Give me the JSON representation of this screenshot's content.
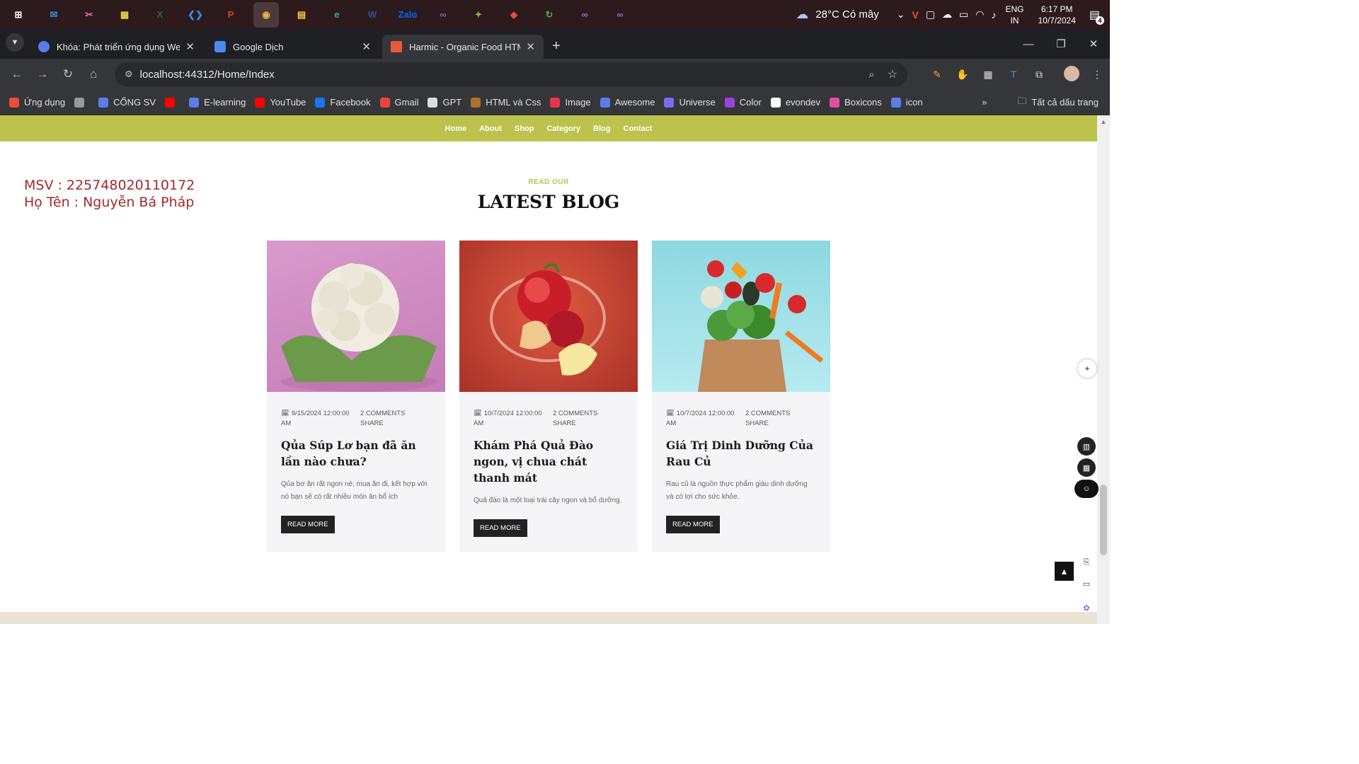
{
  "taskbar": {
    "apps": [
      {
        "name": "windows-start-icon",
        "glyph": "⊞",
        "color": "#ffffff"
      },
      {
        "name": "mail-icon",
        "glyph": "✉",
        "color": "#3b8ce0"
      },
      {
        "name": "snipping-icon",
        "glyph": "✂",
        "color": "#e86aa0"
      },
      {
        "name": "store-icon",
        "glyph": "▦",
        "color": "#e8d24a"
      },
      {
        "name": "excel-icon",
        "glyph": "X",
        "color": "#1e7145"
      },
      {
        "name": "vscode-icon",
        "glyph": "❮❯",
        "color": "#2c8ee8"
      },
      {
        "name": "powerpoint-icon",
        "glyph": "P",
        "color": "#d24726"
      },
      {
        "name": "chrome-icon",
        "glyph": "◉",
        "color": "#e8b83a"
      },
      {
        "name": "file-explorer-icon",
        "glyph": "▤",
        "color": "#f5c542"
      },
      {
        "name": "edge-icon",
        "glyph": "e",
        "color": "#2bb3a8"
      },
      {
        "name": "word-icon",
        "glyph": "W",
        "color": "#2b5797"
      },
      {
        "name": "zalo-icon",
        "glyph": "Zalo",
        "color": "#0068ff"
      },
      {
        "name": "visual-studio-icon",
        "glyph": "∞",
        "color": "#865fc5"
      },
      {
        "name": "app-icon",
        "glyph": "✦",
        "color": "#7cb342"
      },
      {
        "name": "git-icon",
        "glyph": "◆",
        "color": "#e84e3a"
      },
      {
        "name": "app2-icon",
        "glyph": "↻",
        "color": "#4caf50"
      },
      {
        "name": "vs-preview-icon",
        "glyph": "∞",
        "color": "#a066d8"
      },
      {
        "name": "vs-preview2-icon",
        "glyph": "∞",
        "color": "#a066d8"
      }
    ],
    "weather": "28°C  Có mây",
    "lang": "ENG",
    "lang_sub": "IN",
    "time": "6:17 PM",
    "date": "10/7/2024",
    "notif_count": "4"
  },
  "tabs": [
    {
      "title": "Khóa: Phát triển ứng dụng Web",
      "fav": "#5b7de8"
    },
    {
      "title": "Google Dịch",
      "fav": "#4a8af4"
    },
    {
      "title": "Harmic - Organic Food HTML Te",
      "fav": "#e85a3a"
    }
  ],
  "address": {
    "url": "localhost:44312/Home/Index"
  },
  "bookmarks": [
    {
      "label": "Ứng dụng",
      "color": "#e84e3a"
    },
    {
      "label": "",
      "color": "#999999"
    },
    {
      "label": "CỔNG SV",
      "color": "#5b7de8"
    },
    {
      "label": "",
      "color": "#ff0000"
    },
    {
      "label": "E-learning",
      "color": "#5b7de8"
    },
    {
      "label": "YouTube",
      "color": "#ff0000"
    },
    {
      "label": "Facebook",
      "color": "#1877f2"
    },
    {
      "label": "Gmail",
      "color": "#ea4335"
    },
    {
      "label": "GPT",
      "color": "#dddddd"
    },
    {
      "label": "HTML và Css",
      "color": "#b07030"
    },
    {
      "label": "Image",
      "color": "#e8334a"
    },
    {
      "label": "Awesome",
      "color": "#5b7de8"
    },
    {
      "label": "Universe",
      "color": "#7b6cf0"
    },
    {
      "label": "Color",
      "color": "#a040e0"
    },
    {
      "label": "evondev",
      "color": "#ffffff"
    },
    {
      "label": "Boxicons",
      "color": "#e84ea0"
    },
    {
      "label": "icon",
      "color": "#5b7de8"
    }
  ],
  "bookmarks_all": "Tất cả dấu trang",
  "nav": [
    "Home",
    "About",
    "Shop",
    "Category",
    "Blog",
    "Contact"
  ],
  "student": {
    "msv": "MSV : 225748020110172",
    "name": "Họ Tên : Nguyễn Bá Pháp"
  },
  "section": {
    "eyebrow": "READ OUR",
    "title": "LATEST BLOG"
  },
  "posts": [
    {
      "date": "9/15/2024 12:00:00 AM",
      "comments": "2 COMMENTS SHARE",
      "title": "Qủa Súp Lơ bạn đã ăn lần nào chưa?",
      "excerpt": "Qủa bơ ăn rất ngon nè, mua ăn đi, kết hợp với nó bạn sẽ có rất nhiều món ăn bổ ích",
      "button": "READ MORE"
    },
    {
      "date": "10/7/2024 12:00:00 AM",
      "comments": "2 COMMENTS SHARE",
      "title": "Khám Phá Quả Đào ngon, vị chua chát thanh mát",
      "excerpt": "Quả đào là một loại trái cây ngon và bổ dưỡng.",
      "button": "READ MORE"
    },
    {
      "date": "10/7/2024 12:00:00 AM",
      "comments": "2 COMMENTS SHARE",
      "title": "Giá Trị Dinh Dưỡng Của Rau Củ",
      "excerpt": "Rau củ là nguồn thực phẩm giàu dinh dưỡng và có lợi cho sức khỏe.",
      "button": "READ MORE"
    }
  ],
  "colors": {
    "accent": "#bcc34d",
    "student": "#a5292b"
  }
}
